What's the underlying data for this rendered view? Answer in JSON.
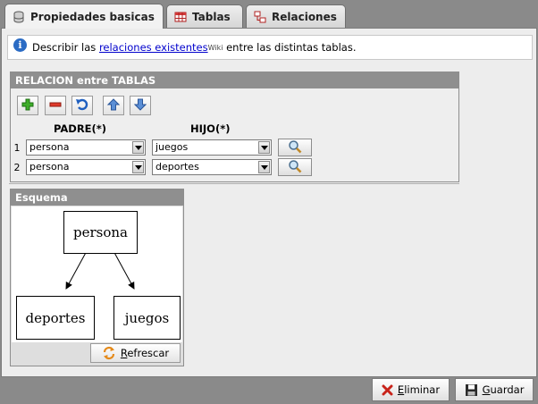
{
  "tabs": [
    {
      "label": "Propiedades basicas",
      "icon": "database-icon",
      "active": true
    },
    {
      "label": "Tablas",
      "icon": "table-icon",
      "active": false
    },
    {
      "label": "Relaciones",
      "icon": "relations-icon",
      "active": false
    }
  ],
  "info": {
    "before": "Describir las ",
    "link": "relaciones existentes",
    "sup": "Wiki",
    "after": " entre las distintas tablas."
  },
  "relation": {
    "title": "RELACION entre TABLAS",
    "toolbar": [
      "add-icon",
      "remove-icon",
      "undo-icon",
      "move-up-icon",
      "move-down-icon"
    ],
    "col_parent": "PADRE(*)",
    "col_child": "HIJO(*)",
    "rows": [
      {
        "num": "1",
        "parent": "persona",
        "child": "juegos"
      },
      {
        "num": "2",
        "parent": "persona",
        "child": "deportes"
      }
    ]
  },
  "schema": {
    "title": "Esquema",
    "root": "persona",
    "children": [
      "deportes",
      "juegos"
    ],
    "refresh_label": "Refrescar"
  },
  "buttons": {
    "delete_label": "Eliminar",
    "save_label": "Guardar"
  },
  "colors": {
    "section_header": "#8f8f8f",
    "link": "#0000cc",
    "background": "#8a8a8a"
  }
}
